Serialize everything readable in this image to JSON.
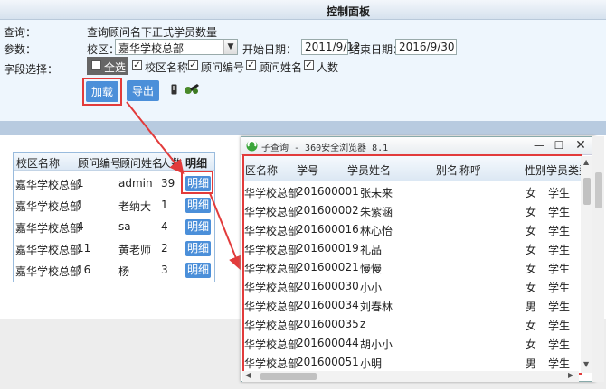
{
  "header": {
    "title": "控制面板"
  },
  "query": {
    "label": "查询：",
    "value": "查询顾问名下正式学员数量"
  },
  "params": {
    "label": "参数：",
    "campus_label": "校区：",
    "campus_value": "嘉华学校总部",
    "start_label": "开始日期：",
    "start_value": "2011/9/12",
    "end_label": "结束日期：",
    "end_value": "2016/9/30"
  },
  "fields": {
    "label": "字段选择：",
    "all_label": "全选",
    "items": [
      "校区名称",
      "顾问编号",
      "顾问姓名",
      "人数"
    ]
  },
  "buttons": {
    "load": "加载",
    "export": "导出"
  },
  "left_table": {
    "headers": [
      "校区名称",
      "顾问编号",
      "顾问姓名",
      "人数",
      "明细"
    ],
    "rows": [
      {
        "campus": "嘉华学校总部",
        "id": "1",
        "name": "admin",
        "count": "39",
        "detail": "明细"
      },
      {
        "campus": "嘉华学校总部",
        "id": "1",
        "name": "老纳大",
        "count": "1",
        "detail": "明细"
      },
      {
        "campus": "嘉华学校总部",
        "id": "4",
        "name": "sa",
        "count": "4",
        "detail": "明细"
      },
      {
        "campus": "嘉华学校总部",
        "id": "11",
        "name": "黄老师",
        "count": "2",
        "detail": "明细"
      },
      {
        "campus": "嘉华学校总部",
        "id": "16",
        "name": "杨",
        "count": "3",
        "detail": "明细"
      }
    ]
  },
  "popup": {
    "title": "子查询 - 360安全浏览器 8.1",
    "headers": [
      "区名称",
      "学号",
      "学员姓名",
      "别名",
      "称呼",
      "性别",
      "学员类型"
    ],
    "rows": [
      {
        "campus": "华学校总部",
        "sid": "201600001",
        "name": "张未来",
        "gender": "女",
        "type": "学生"
      },
      {
        "campus": "华学校总部",
        "sid": "201600002",
        "name": "朱紫涵",
        "gender": "女",
        "type": "学生"
      },
      {
        "campus": "华学校总部",
        "sid": "201600016",
        "name": "林心怡",
        "gender": "女",
        "type": "学生"
      },
      {
        "campus": "华学校总部",
        "sid": "201600019",
        "name": "礼品",
        "gender": "女",
        "type": "学生"
      },
      {
        "campus": "华学校总部",
        "sid": "201600021",
        "name": "慢慢",
        "gender": "女",
        "type": "学生"
      },
      {
        "campus": "华学校总部",
        "sid": "201600030",
        "name": "小小",
        "gender": "女",
        "type": "学生"
      },
      {
        "campus": "华学校总部",
        "sid": "201600034",
        "name": "刘春林",
        "gender": "男",
        "type": "学生"
      },
      {
        "campus": "华学校总部",
        "sid": "201600035",
        "name": "z",
        "gender": "女",
        "type": "学生"
      },
      {
        "campus": "华学校总部",
        "sid": "201600044",
        "name": "胡小小",
        "gender": "女",
        "type": "学生"
      },
      {
        "campus": "华学校总部",
        "sid": "201600051",
        "name": "小明",
        "gender": "男",
        "type": "学生"
      }
    ]
  },
  "colors": {
    "accent": "#4b8fd9",
    "highlight": "#e23b3b",
    "panel_bg": "#eef6fd"
  }
}
